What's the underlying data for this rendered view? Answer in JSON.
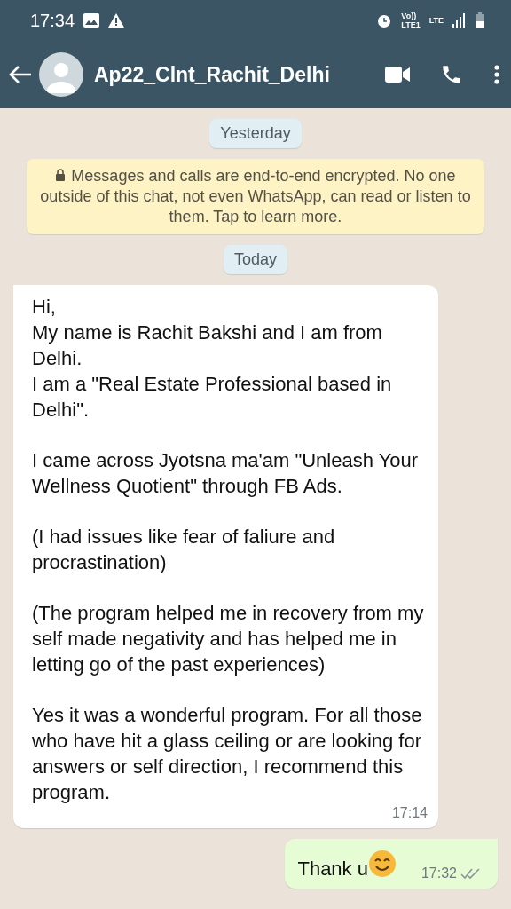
{
  "status_bar": {
    "time": "17:34",
    "volte": "Vo))",
    "sim": "LTE1",
    "network": "LTE"
  },
  "header": {
    "contact_name": "Ap22_Clnt_Rachit_Delhi"
  },
  "chat": [
    {
      "kind": "date",
      "text": "Yesterday"
    },
    {
      "kind": "notice",
      "text": "Messages and calls are end-to-end encrypted. No one outside of this chat, not even WhatsApp, can read or listen to them. Tap to learn more."
    },
    {
      "kind": "date",
      "text": "Today"
    },
    {
      "kind": "incoming",
      "paragraphs": [
        "Hi,\nMy name is Rachit Bakshi and I am from Delhi.\nI am a \"Real Estate Professional based in Delhi\".",
        "I came across Jyotsna ma'am \"Unleash Your Wellness Quotient\" through FB Ads.",
        "(I had issues like fear of faliure and procrastination)",
        "(The program helped me in recovery from my self made negativity and has helped me in letting go of the past experiences)",
        "Yes it was a wonderful program. For all those who have hit a glass ceiling or are looking for answers or self direction, I recommend this program."
      ],
      "time": "17:14"
    },
    {
      "kind": "outgoing",
      "paragraphs": [
        "Thank u"
      ],
      "emoji": true,
      "time": "17:32",
      "read": false
    }
  ]
}
